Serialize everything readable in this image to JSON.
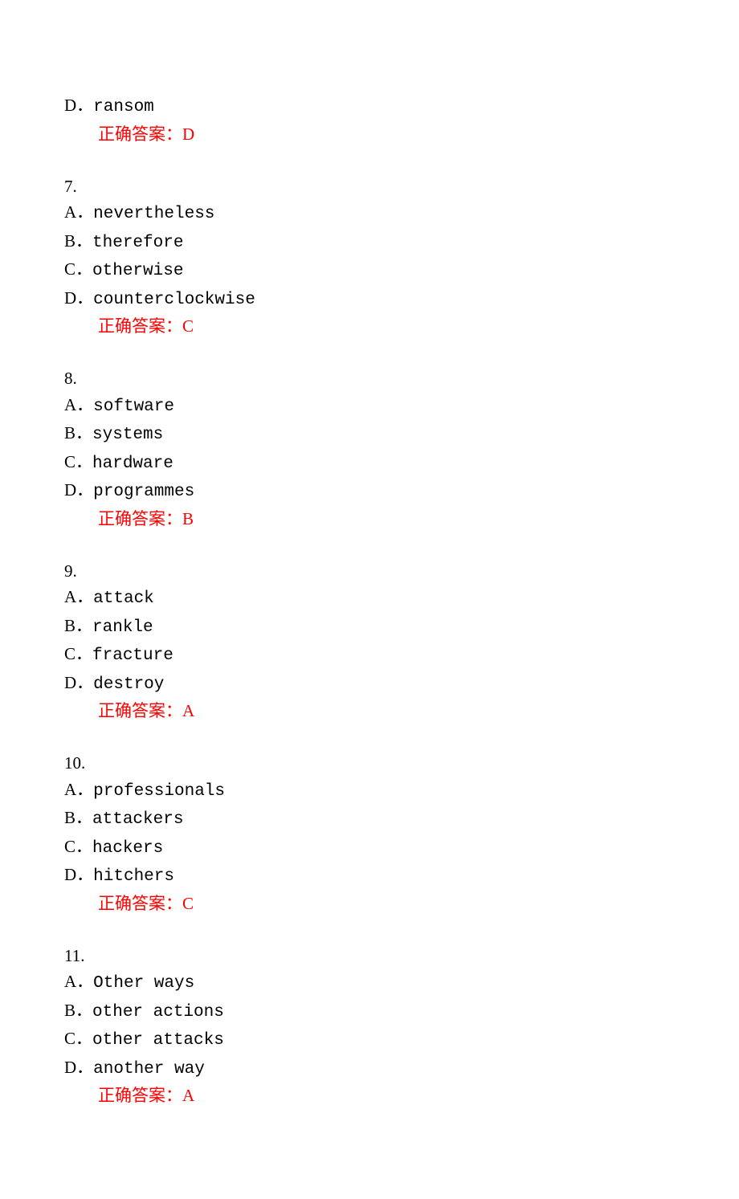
{
  "answer_label": "正确答案：",
  "leading": {
    "option": {
      "letter": "D",
      "text": "ransom"
    },
    "answer": "D"
  },
  "questions": [
    {
      "number": "7.",
      "options": [
        {
          "letter": "A",
          "text": "nevertheless"
        },
        {
          "letter": "B",
          "text": "therefore"
        },
        {
          "letter": "C",
          "text": "otherwise"
        },
        {
          "letter": "D",
          "text": "counterclockwise"
        }
      ],
      "answer": "C"
    },
    {
      "number": "8.",
      "options": [
        {
          "letter": "A",
          "text": "software"
        },
        {
          "letter": "B",
          "text": "systems"
        },
        {
          "letter": "C",
          "text": "hardware"
        },
        {
          "letter": "D",
          "text": "programmes"
        }
      ],
      "answer": "B"
    },
    {
      "number": "9.",
      "options": [
        {
          "letter": "A",
          "text": "attack"
        },
        {
          "letter": "B",
          "text": "rankle"
        },
        {
          "letter": "C",
          "text": "fracture"
        },
        {
          "letter": "D",
          "text": "destroy"
        }
      ],
      "answer": "A"
    },
    {
      "number": "10.",
      "options": [
        {
          "letter": "A",
          "text": "professionals"
        },
        {
          "letter": "B",
          "text": "attackers"
        },
        {
          "letter": "C",
          "text": "hackers"
        },
        {
          "letter": "D",
          "text": "hitchers"
        }
      ],
      "answer": "C"
    },
    {
      "number": "11.",
      "options": [
        {
          "letter": "A",
          "text": "Other ways"
        },
        {
          "letter": "B",
          "text": "other actions"
        },
        {
          "letter": "C",
          "text": "other attacks"
        },
        {
          "letter": "D",
          "text": "another way"
        }
      ],
      "answer": "A"
    }
  ]
}
